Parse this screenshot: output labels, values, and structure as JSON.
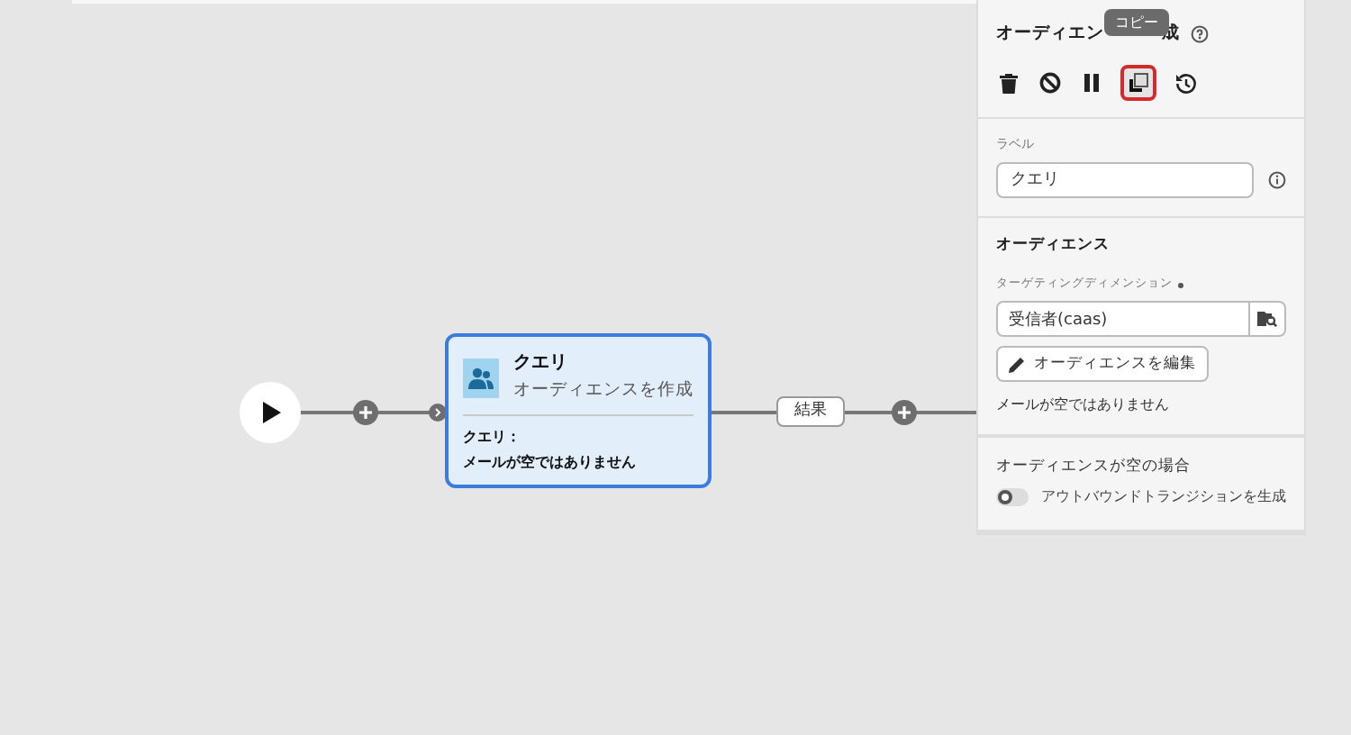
{
  "canvas": {
    "start_node": {
      "kind": "start"
    },
    "activity": {
      "title": "クエリ",
      "subtitle": "オーディエンスを作成",
      "detail_label": "クエリ：",
      "detail_value": "メールが空ではありません",
      "selected": true
    },
    "transition_label": "結果"
  },
  "panel": {
    "title_start": "オーディエン",
    "title_end": "成",
    "toolbar": [
      {
        "kind": "delete",
        "selected": false
      },
      {
        "kind": "disable",
        "selected": false
      },
      {
        "kind": "pause",
        "selected": false
      },
      {
        "kind": "copy",
        "selected": true
      },
      {
        "kind": "history",
        "selected": false
      }
    ],
    "tooltip": "コピー",
    "label_field": {
      "label": "ラベル",
      "value": "クエリ"
    },
    "audience": {
      "heading": "オーディエンス",
      "dimension_label": "ターゲティングディメンション",
      "dimension_value": "受信者(caas)",
      "edit_button": "オーディエンスを編集",
      "summary": "メールが空ではありません"
    },
    "empty_section": {
      "heading": "オーディエンスが空の場合",
      "toggle_label": "アウトバウンドトランジションを生成",
      "on": false
    }
  }
}
